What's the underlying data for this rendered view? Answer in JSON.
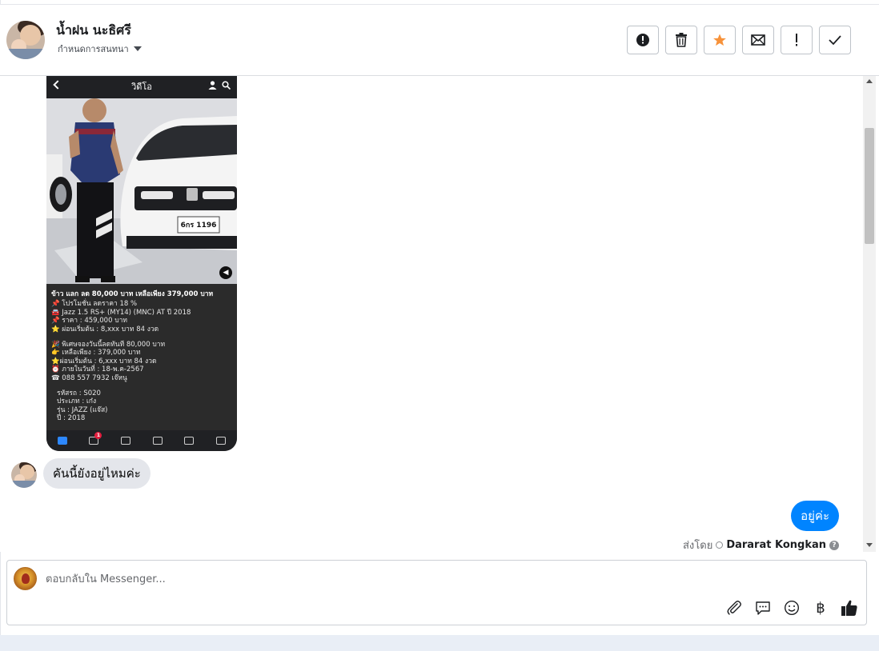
{
  "header": {
    "contact_name": "น้ำฝน นะธิศรี",
    "conversation_settings": "กำหนดการสนทนา",
    "actions": [
      {
        "name": "report-spam-button",
        "icon": "alert-circle-icon"
      },
      {
        "name": "delete-button",
        "icon": "trash-icon"
      },
      {
        "name": "star-button",
        "icon": "star-icon",
        "color": "#f7923a"
      },
      {
        "name": "mark-unread-button",
        "icon": "envelope-icon"
      },
      {
        "name": "follow-up-button",
        "icon": "exclamation-icon"
      },
      {
        "name": "mark-done-button",
        "icon": "check-icon"
      }
    ]
  },
  "attachment": {
    "top_bar_title": "วิดีโอ",
    "plate": "6กร 1196",
    "headline": "ข้าว แลก ลด 80,000 บาท เหลือเพียง 379,000 บาท",
    "lines_a": [
      "📌 โปรโมชั่น ลดราคา 18 %",
      "🚘 Jazz 1.5 RS+ (MY14) (MNC) AT ปี 2018",
      "📌 ราคา : 459,000 บาท",
      "⭐ ผ่อนเริ่มต้น : 8,xxx บาท 84 งวด"
    ],
    "lines_b": [
      "🎉 พิเศษจองวันนี้ลดทันที 80,000 บาท",
      "👉 เหลือเพียง : 379,000 บาท",
      "⭐ผ่อนเริ่มต้น : 6,xxx บาท 84 งวด",
      "⏰ ภายในวันที่ : 18-พ.ค-2567",
      "☎ 088 557 7932 เจ๊หนู"
    ],
    "lines_c": [
      "รหัสรถ : S020",
      "ประเภท : เก๋ง",
      "รุ่น : JAZZ (แจ๊ส)",
      "ปี : 2018"
    ],
    "nav_badge": "1"
  },
  "messages": {
    "incoming": "คันนี้ยังอยู่ไหมค่ะ",
    "outgoing": "อยู่ค่ะ",
    "sent_by_label": "ส่งโดย",
    "sent_by_name": "Dararat Kongkan",
    "help": "?"
  },
  "composer": {
    "placeholder": "ตอบกลับใน Messenger...",
    "baht_symbol": "฿",
    "tools": [
      "attach-icon",
      "saved-reply-icon",
      "emoji-icon",
      "baht-icon",
      "like-icon"
    ]
  },
  "colors": {
    "outgoing_bubble": "#0084ff",
    "incoming_bubble": "#e4e6eb",
    "star": "#f7923a"
  }
}
